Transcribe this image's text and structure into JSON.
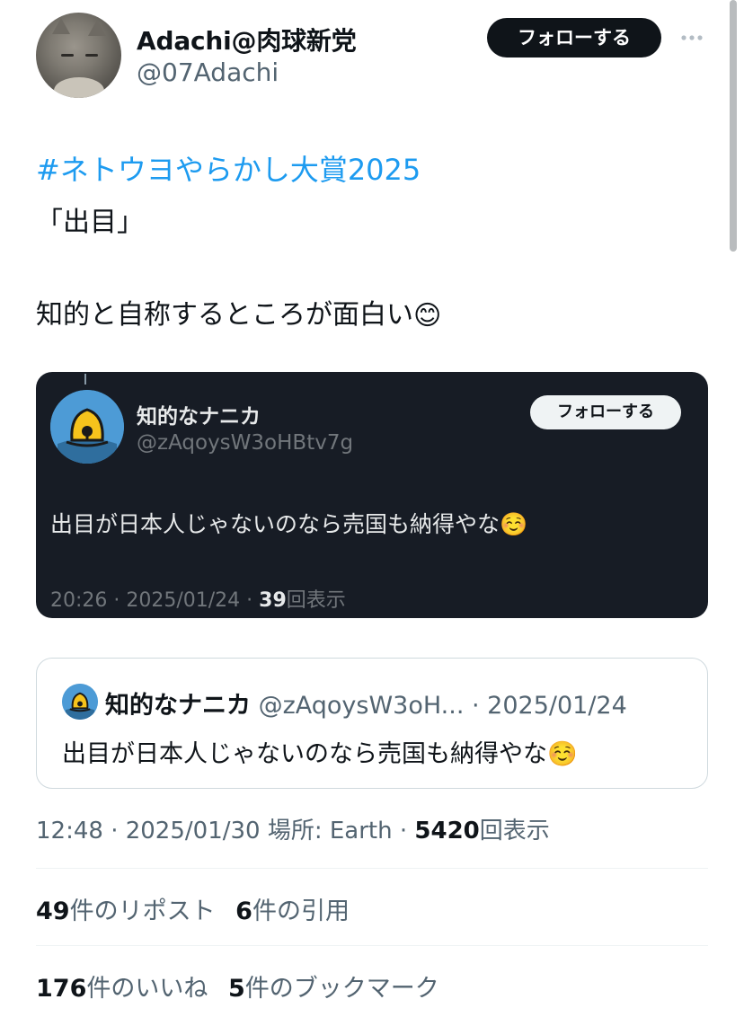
{
  "author": {
    "display_name": "Adachi@肉球新党",
    "handle": "@07Adachi",
    "follow_label": "フォローする",
    "more_icon": "ellipsis-icon"
  },
  "tweet": {
    "hashtag": "#ネトウヨやらかし大賞2025",
    "line2": "「出目」",
    "line3": "知的と自称するところが面白い",
    "line3_emoji": "😊"
  },
  "screenshot": {
    "display_name": "知的なナニカ",
    "handle": "@zAqoysW3oHBtv7g",
    "follow_label": "フォローする",
    "text": "出目が日本人じゃないのなら売国も納得やな",
    "text_emoji": "☺️",
    "meta_time": "20:26 · 2025/01/24 · ",
    "meta_views": "39",
    "meta_views_label": "回表示"
  },
  "quote": {
    "display_name": "知的なナニカ",
    "handle_and_date": " @zAqoysW3oH... · 2025/01/24",
    "text": "出目が日本人じゃないのなら売国も納得やな",
    "text_emoji": "☺️"
  },
  "meta": {
    "time_location": "12:48 · 2025/01/30 場所: Earth · ",
    "views": "5420",
    "views_label": "回表示"
  },
  "stats": {
    "reposts": "49",
    "reposts_label": "件のリポスト",
    "quotes": "6",
    "quotes_label": "件の引用",
    "likes": "176",
    "likes_label": "件のいいね",
    "bookmarks": "5",
    "bookmarks_label": "件のブックマーク"
  },
  "colors": {
    "link": "#1d9bf0",
    "card_dark": "#171c25",
    "secondary_text": "#536471"
  }
}
